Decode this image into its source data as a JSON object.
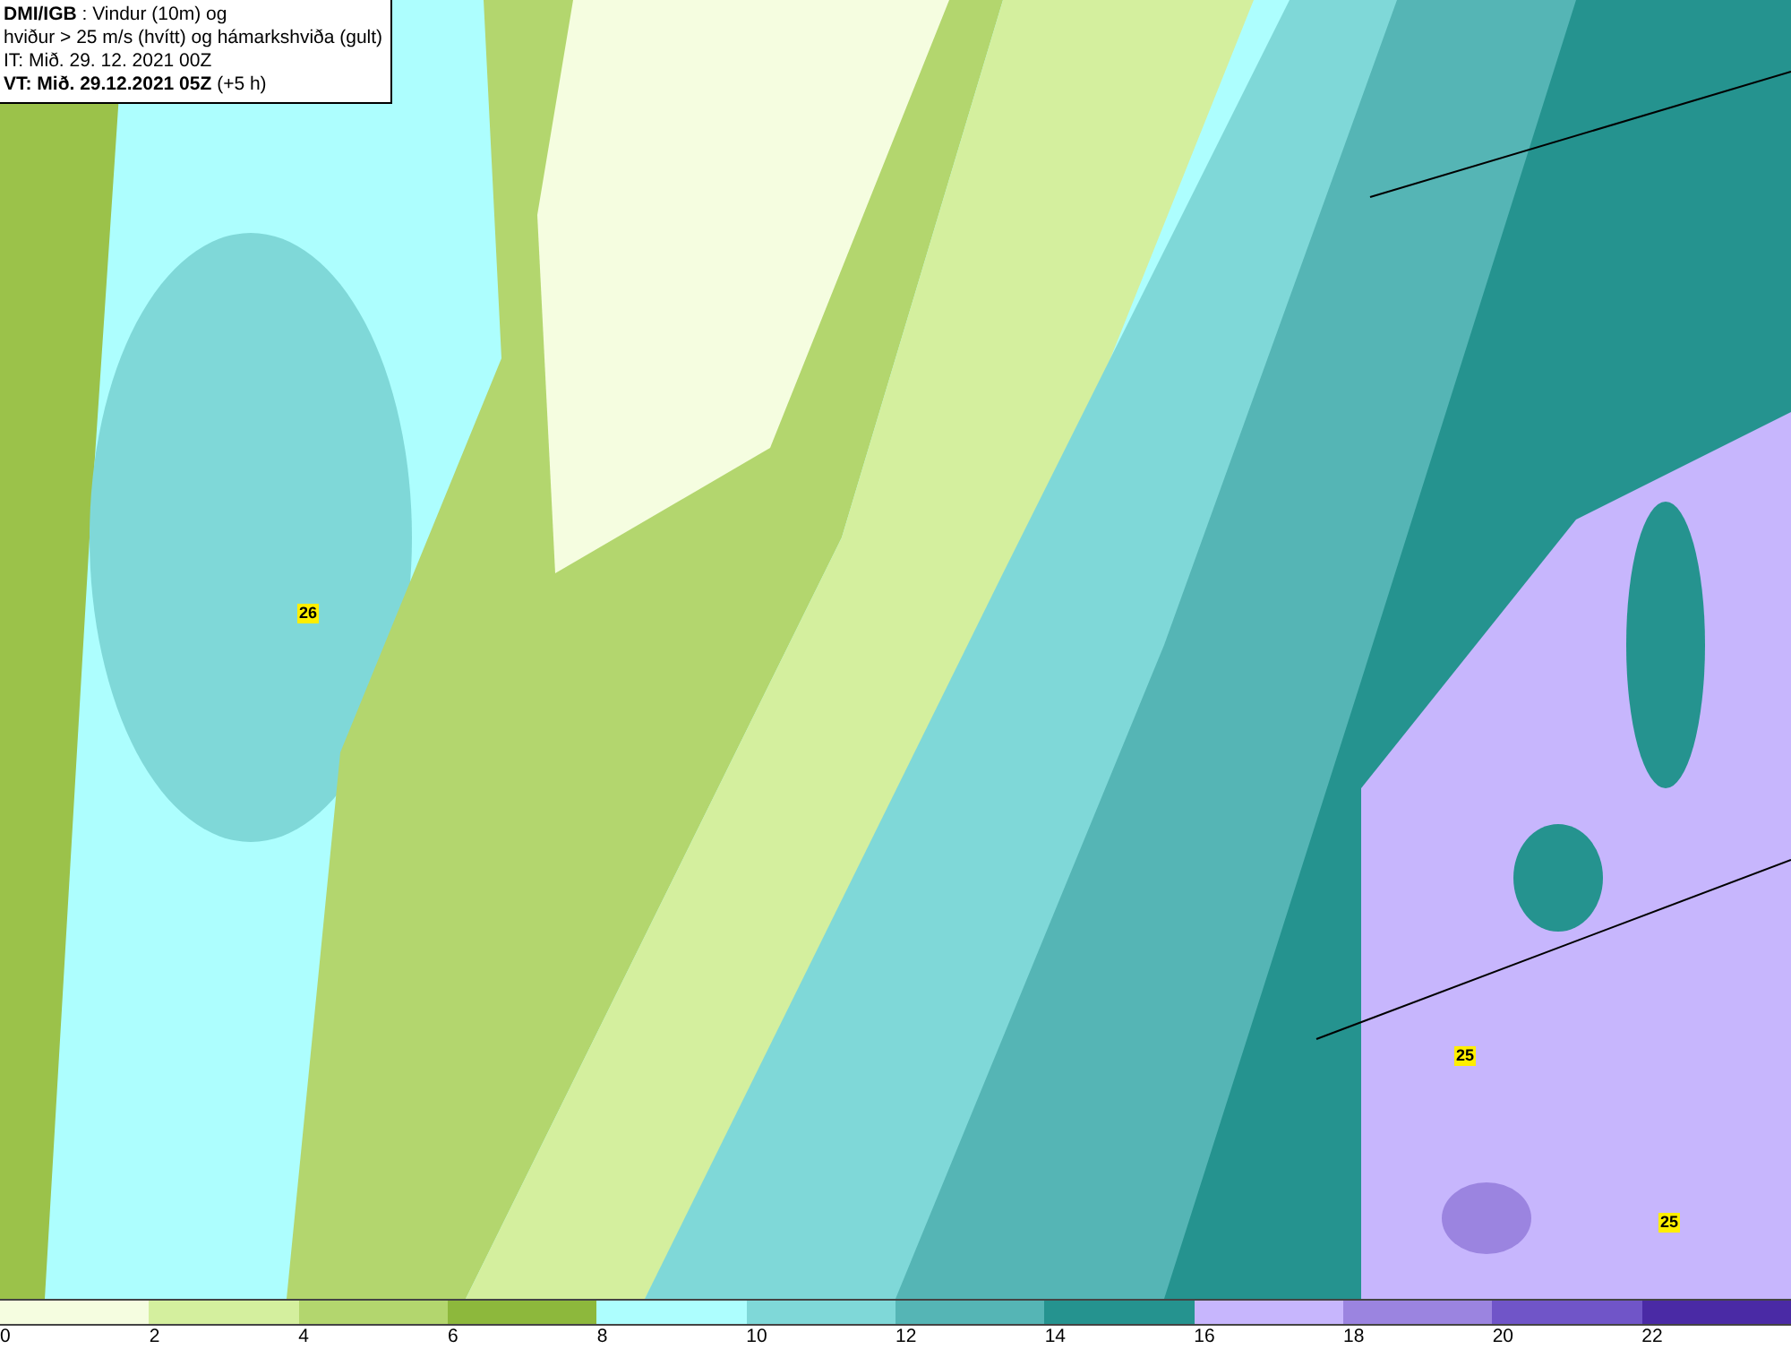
{
  "header": {
    "lines": [
      "**DMI/IGB** : Vindur (10m) og",
      "hviður > 25 m/s (hvítt) og hámarkshviða (gult)",
      "IT: Mið. 29. 12. 2021 00Z",
      "**VT: Mið. 29.12.2021 05Z** (+5 h)"
    ]
  },
  "gust_markers": [
    {
      "value": "26"
    },
    {
      "value": "25"
    },
    {
      "value": "25"
    }
  ],
  "legend": {
    "bins": [
      {
        "color": "#f5fde0"
      },
      {
        "color": "#d4ef9e"
      },
      {
        "color": "#b3d66e"
      },
      {
        "color": "#8db83c"
      },
      {
        "color": "#adfefe"
      },
      {
        "color": "#7fd8d8"
      },
      {
        "color": "#55b5b5"
      },
      {
        "color": "#25938f"
      },
      {
        "color": "#c7b6fd"
      },
      {
        "color": "#9b84e0"
      },
      {
        "color": "#7055c8"
      },
      {
        "color": "#4a2aa5"
      }
    ],
    "ticks": [
      "0",
      "2",
      "4",
      "6",
      "8",
      "10",
      "12",
      "14",
      "16",
      "18",
      "20",
      "22"
    ]
  }
}
